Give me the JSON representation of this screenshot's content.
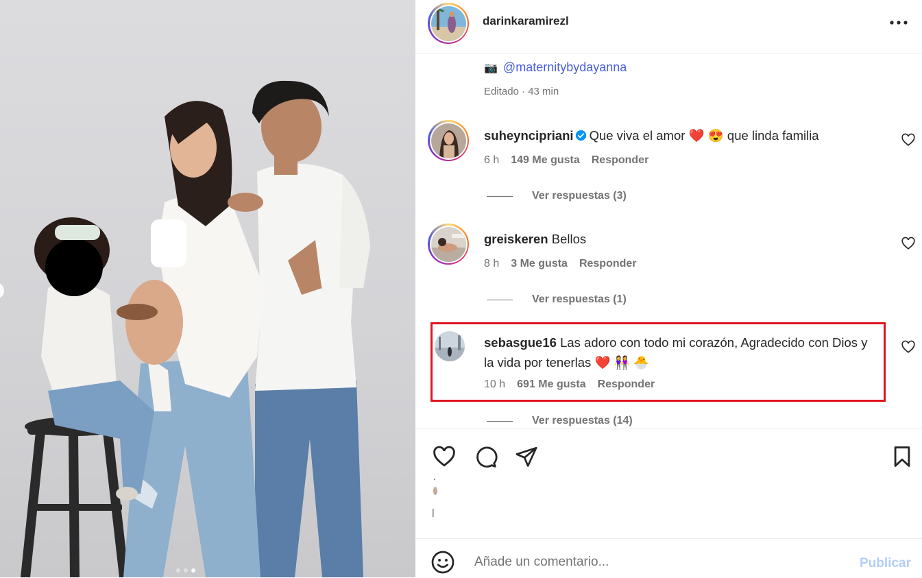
{
  "post": {
    "username": "darinkaramirezl",
    "caption_mention": "@maternitybydayanna",
    "caption_meta": "Editado · 43 min"
  },
  "comments": [
    {
      "username": "suheyncipriani",
      "verified": true,
      "text": "Que viva el amor ❤️ 😍 que linda familia",
      "time": "6 h",
      "likes": "149 Me gusta",
      "reply": "Responder",
      "view_replies": "Ver respuestas (3)"
    },
    {
      "username": "greiskeren",
      "verified": false,
      "text": "Bellos",
      "time": "8 h",
      "likes": "3 Me gusta",
      "reply": "Responder",
      "view_replies": "Ver respuestas (1)"
    },
    {
      "username": "sebasgue16",
      "verified": false,
      "text": "Las adoro con todo mi corazón, Agradecido con Dios y la vida por tenerlas ❤️ 👭 🐣",
      "time": "10 h",
      "likes": "691 Me gusta",
      "reply": "Responder",
      "view_replies": "Ver respuestas (14)",
      "highlighted": true
    }
  ],
  "actions": {
    "like_icon": "heart-outline-icon",
    "comment_icon": "comment-bubble-icon",
    "share_icon": "paper-plane-icon",
    "save_icon": "bookmark-icon"
  },
  "add_comment": {
    "placeholder": "Añade un comentario...",
    "publish_label": "Publicar"
  },
  "carousel": {
    "slides": 3,
    "active": 3
  },
  "colors": {
    "highlight_border": "#e0141f",
    "link_blue": "#4a5de0",
    "publish_disabled": "#b3cdf7",
    "verified_blue": "#0095f6"
  }
}
